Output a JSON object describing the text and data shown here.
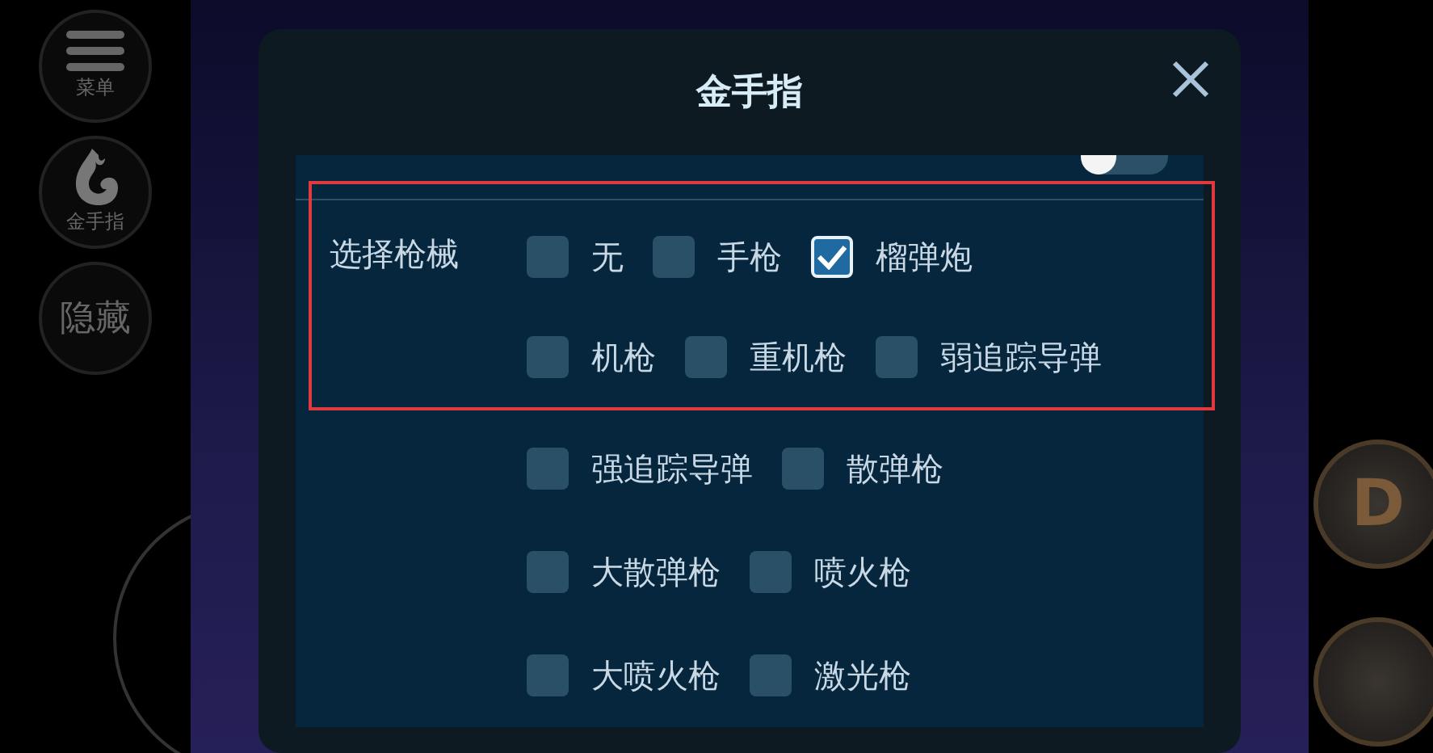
{
  "side_buttons": [
    {
      "kind": "menu",
      "label": "菜单"
    },
    {
      "kind": "cheat",
      "label": "金手指"
    },
    {
      "kind": "text",
      "label": "隐藏"
    }
  ],
  "dialog": {
    "title": "金手指",
    "toggle": {
      "on": false
    },
    "highlighted_group": {
      "label": "选择枪械",
      "rows": [
        [
          {
            "label": "无",
            "checked": false
          },
          {
            "label": "手枪",
            "checked": false
          },
          {
            "label": "榴弹炮",
            "checked": true
          }
        ],
        [
          {
            "label": "机枪",
            "checked": false
          },
          {
            "label": "重机枪",
            "checked": false
          },
          {
            "label": "弱追踪导弹",
            "checked": false
          }
        ]
      ]
    },
    "more_rows": [
      [
        {
          "label": "强追踪导弹",
          "checked": false
        },
        {
          "label": "散弹枪",
          "checked": false
        }
      ],
      [
        {
          "label": "大散弹枪",
          "checked": false
        },
        {
          "label": "喷火枪",
          "checked": false
        }
      ],
      [
        {
          "label": "大喷火枪",
          "checked": false
        },
        {
          "label": "激光枪",
          "checked": false
        }
      ]
    ]
  },
  "action_buttons": [
    {
      "label": "D"
    }
  ]
}
